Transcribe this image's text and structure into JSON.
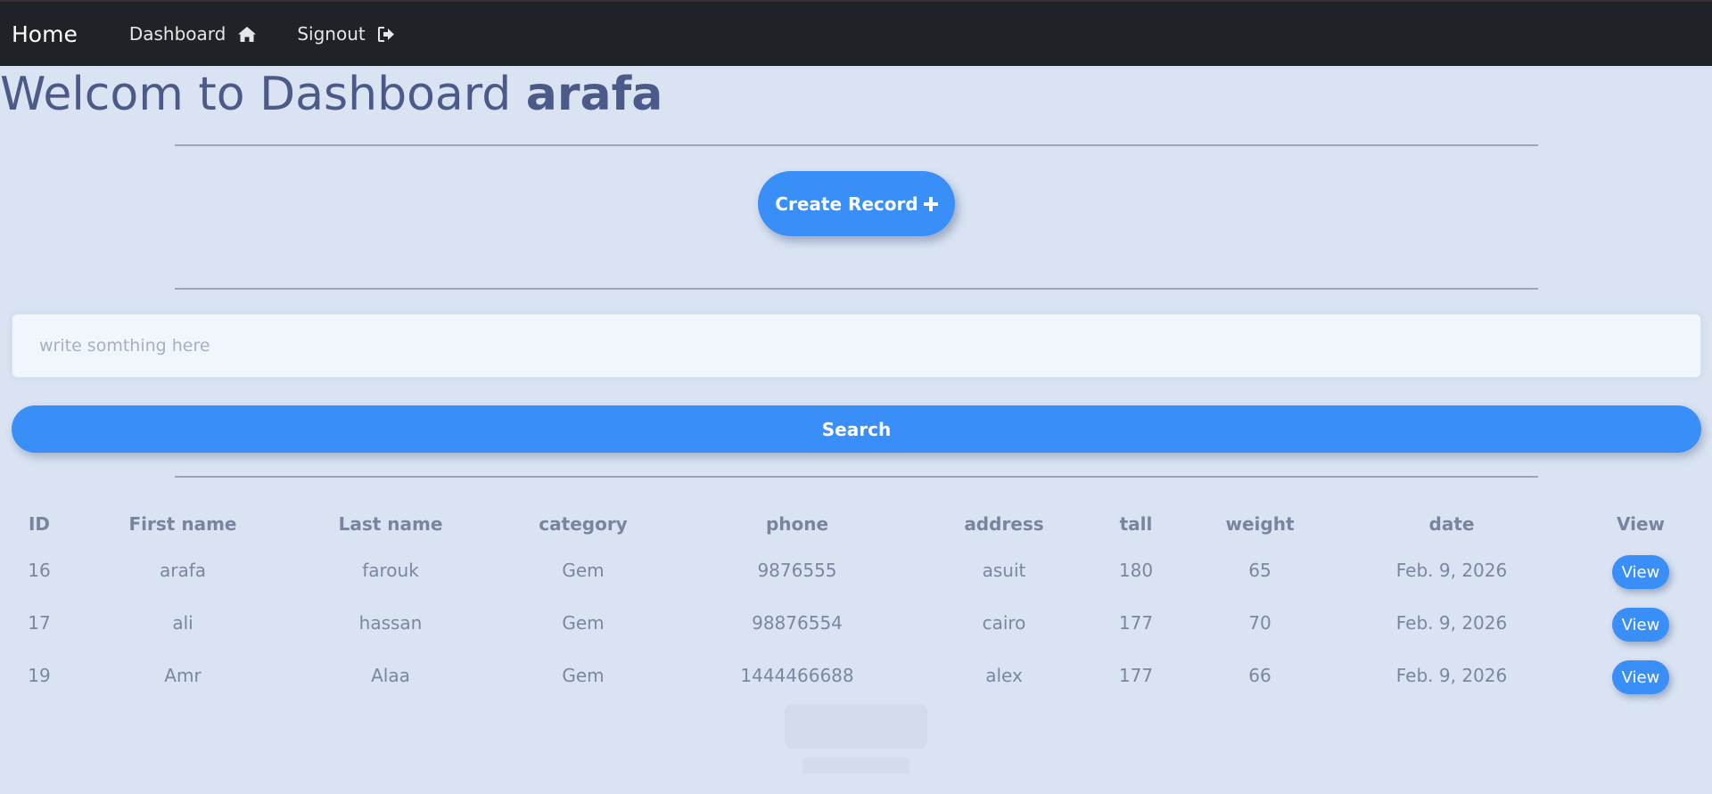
{
  "nav": {
    "brand": "Home",
    "dashboard_label": "Dashboard",
    "signout_label": "Signout",
    "dashboard_icon": "home-icon",
    "signout_icon": "sign-out-icon"
  },
  "welcome": {
    "prefix": "Welcom to Dashboard ",
    "username": "arafa"
  },
  "create_button": {
    "label": "Create Record",
    "icon": "plus-icon"
  },
  "search": {
    "placeholder": "write somthing here",
    "value": "",
    "button_label": "Search"
  },
  "table": {
    "headers": [
      "ID",
      "First name",
      "Last name",
      "category",
      "phone",
      "address",
      "tall",
      "weight",
      "date",
      "View"
    ],
    "rows": [
      {
        "id": "16",
        "first": "arafa",
        "last": "farouk",
        "category": "Gem",
        "phone": "9876555",
        "address": "asuit",
        "tall": "180",
        "weight": "65",
        "date": "Feb. 9, 2026",
        "view": "View"
      },
      {
        "id": "17",
        "first": "ali",
        "last": "hassan",
        "category": "Gem",
        "phone": "98876554",
        "address": "cairo",
        "tall": "177",
        "weight": "70",
        "date": "Feb. 9, 2026",
        "view": "View"
      },
      {
        "id": "19",
        "first": "Amr",
        "last": "Alaa",
        "category": "Gem",
        "phone": "1444466688",
        "address": "alex",
        "tall": "177",
        "weight": "66",
        "date": "Feb. 9, 2026",
        "view": "View"
      }
    ]
  },
  "colors": {
    "background": "#d9e3f2",
    "navbar": "#1f2226",
    "accent": "#3a8ef8",
    "heading": "#4b5a88",
    "table_text": "#7c86a0"
  }
}
